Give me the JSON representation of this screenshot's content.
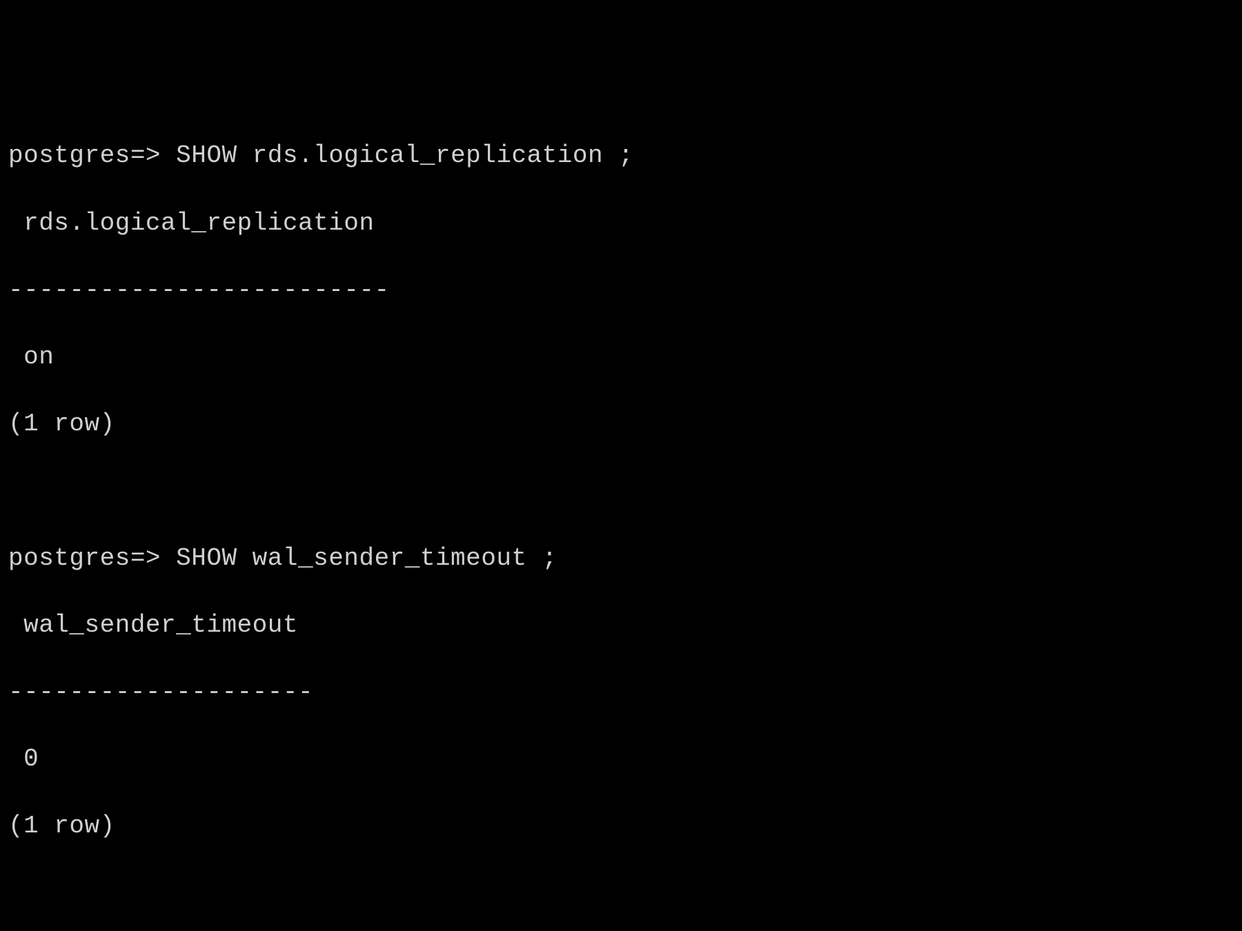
{
  "terminal": {
    "queries": [
      {
        "prompt": "postgres=>",
        "command": "SHOW rds.logical_replication ;",
        "header": " rds.logical_replication",
        "separator": "-------------------------",
        "value": " on",
        "footer": "(1 row)"
      },
      {
        "prompt": "postgres=>",
        "command": "SHOW wal_sender_timeout ;",
        "header": " wal_sender_timeout",
        "separator": "--------------------",
        "value": " 0",
        "footer": "(1 row)"
      }
    ]
  }
}
